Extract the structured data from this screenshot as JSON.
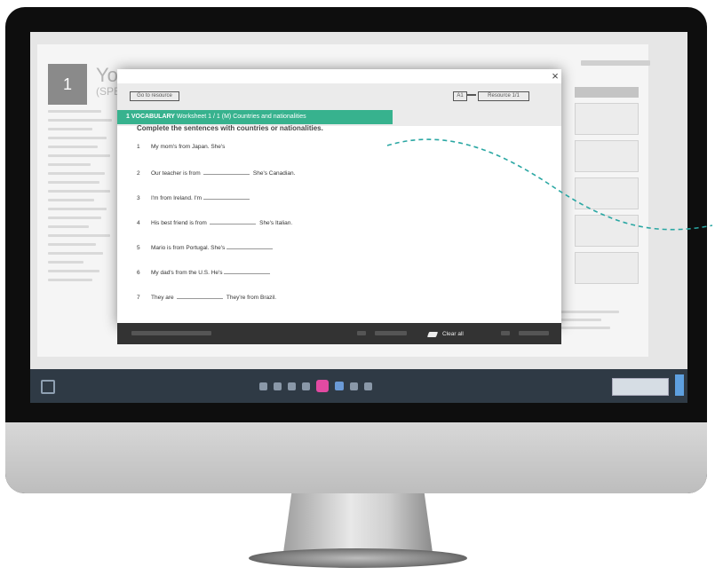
{
  "book": {
    "unit_number": "1",
    "unit_title": "You",
    "unit_subtitle": "(SPE"
  },
  "modal": {
    "close_label": "×",
    "back_label": "Go to resource",
    "level_label": "A1",
    "resource_label": "Resource 1/1",
    "banner_bold": "1 VOCABULARY",
    "banner_rest": " Worksheet 1 / 1 (M) Countries and nationalities",
    "instruction": "Complete the sentences with countries or nationalities.",
    "questions": [
      {
        "n": "1",
        "before": "My mom's from Japan. She's",
        "after": ""
      },
      {
        "n": "2",
        "before": "Our teacher is from",
        "after": "She's Canadian."
      },
      {
        "n": "3",
        "before": "I'm from Ireland. I'm",
        "after": ""
      },
      {
        "n": "4",
        "before": "His best friend is from",
        "after": "She's Italian."
      },
      {
        "n": "5",
        "before": "Mario is from Portugal. She's",
        "after": ""
      },
      {
        "n": "6",
        "before": "My dad's from the U.S. He's",
        "after": ""
      },
      {
        "n": "7",
        "before": "They are",
        "after": "They're from Brazil."
      }
    ],
    "clear_all_label": "Clear all"
  },
  "colors": {
    "accent": "#37b28e",
    "curve": "#2aa7a3",
    "toolbar": "#2f3a45",
    "highlight": "#e24aa2"
  },
  "icons": [
    "close-icon",
    "eraser-icon",
    "page-nav-icons",
    "curve-decoration"
  ]
}
